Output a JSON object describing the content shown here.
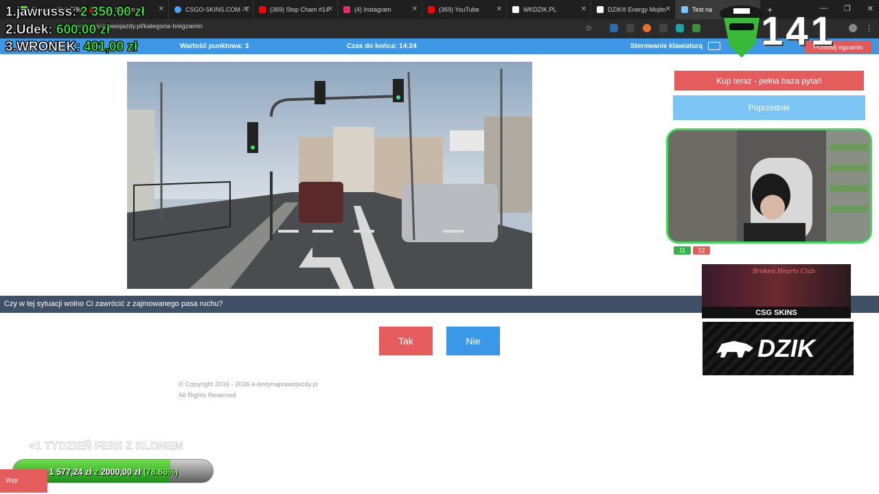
{
  "browser": {
    "tabs": [
      {
        "label": "Stream - Kick Dash",
        "favicon_color": "#53fc18"
      },
      {
        "label": "Klon Stream - Y",
        "favicon_color": "#ff0000"
      },
      {
        "label": "CSGO-SKINS.COM - F",
        "favicon_color": "#4aa3ff"
      },
      {
        "label": "(369) Stop Cham #14",
        "favicon_color": "#ff0000"
      },
      {
        "label": "(4) Instagram",
        "favicon_color": "#e1306c"
      },
      {
        "label": "(369) YouTube",
        "favicon_color": "#ff0000"
      },
      {
        "label": "WKDZIK.PL",
        "favicon_color": "#ffffff"
      },
      {
        "label": "DZIK® Energy Mojito",
        "favicon_color": "#ffffff"
      },
      {
        "label": "Test na",
        "favicon_color": "#7cc4f4"
      }
    ],
    "new_tab": "+",
    "url": "e-testynaprawojazdy.pl/kategoria-b/egzamin",
    "star": "☆"
  },
  "site_header": {
    "score_label": "Wartość punktowa: 3",
    "time_label": "Czas do końca: 14:24",
    "keyboard_label": "Sterowanie klawiaturą",
    "stop_button": "Przerwij egzamin"
  },
  "question": {
    "text": "Czy w tej sytuacji wolno Ci zawrócić z zajmowanego pasa ruchu?",
    "answer_yes": "Tak",
    "answer_no": "Nie"
  },
  "footer": {
    "copyright": "© Copyright 2016 - 2026 e-testynaprawojazdy.pl",
    "rights": "All Rights Reserved"
  },
  "sidebar": {
    "buy_button": "Kup teraz - pełna baza pytań",
    "prev_button": "Poprzednie",
    "count_green": "11",
    "count_red": "12",
    "ad1_title": "Broken Hearts Club",
    "ad1_brand": "CSG SKINS",
    "ad2_brand": "DZIK"
  },
  "overlay": {
    "leaderboard": [
      {
        "name": "1.jawrusss:",
        "value": "2 350,00 zł"
      },
      {
        "name": "2.Udek:",
        "value": "600,00 zł"
      },
      {
        "name": "3.WRONEK:",
        "value": "401,00 zł"
      }
    ],
    "counter": "141",
    "goal_title": "+1 TYDZIEŃ FERII Z KLONEM",
    "goal_current": "1 577,24 zł",
    "goal_z": "z",
    "goal_target": "2000,00 zł",
    "goal_percent": "(78.86%)",
    "goal_fraction": 0.7886,
    "wyp_label": "Wyp"
  },
  "colors": {
    "site_blue": "#3d97e4",
    "question_bar": "#3f5166",
    "red_button": "#e45c5c",
    "blue_button": "#3b98e8",
    "light_blue_button": "#7cc4f4",
    "cam_border": "#3ddc5a"
  }
}
